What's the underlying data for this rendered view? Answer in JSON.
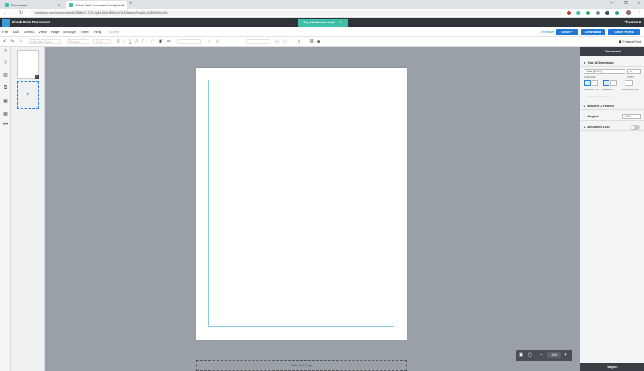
{
  "browser": {
    "tabs": [
      {
        "label": "Documents"
      },
      {
        "label": "Blank Print Document Lucidpress"
      }
    ],
    "new_tab": "+",
    "url": "lucidpress.com/documents/edit/7586fe77-773e-4a61-93ce-3f98ecd7a15?beaconFlowId=451369f0d0c94f4",
    "window_controls": [
      "–",
      "❐",
      "✕"
    ]
  },
  "app": {
    "doc_title": "Blank Print Document",
    "try_button": "Try add feature feed",
    "user": "Thomas ▾"
  },
  "menubar": {
    "items": [
      "File",
      "Edit",
      "Select",
      "View",
      "Page",
      "Arrange",
      "Insert",
      "Help"
    ],
    "saved": "saved",
    "preview": "Preview",
    "share": "Share ▾",
    "download": "Download",
    "order_prints": "Order Prints"
  },
  "toolbar": {
    "font": "Liberation Sans",
    "style": "Regular",
    "size": "10 pt",
    "feature_find": "Feature Find"
  },
  "thumbs": {
    "page_number": "1",
    "add": "+"
  },
  "canvas": {
    "add_page": "Add a New Page",
    "zoom": "110%"
  },
  "right_panel": {
    "title": "Document",
    "size_section": "Size & Orientation",
    "page_size": "Letter (8.5x11)",
    "page_size_label": "PAGE SIZE",
    "units": "in",
    "units_label": "UNITS",
    "orientation_label": "ORIENTATION",
    "spreads_label": "SPREADS",
    "background_label": "BACKGROUND",
    "ghost_text": "Lock Page Background",
    "headers_section": "Headers & Footers",
    "margins_section": "Margins",
    "margins_value": "0.5 in",
    "lock_section": "Document Lock",
    "layers": "Layers"
  }
}
